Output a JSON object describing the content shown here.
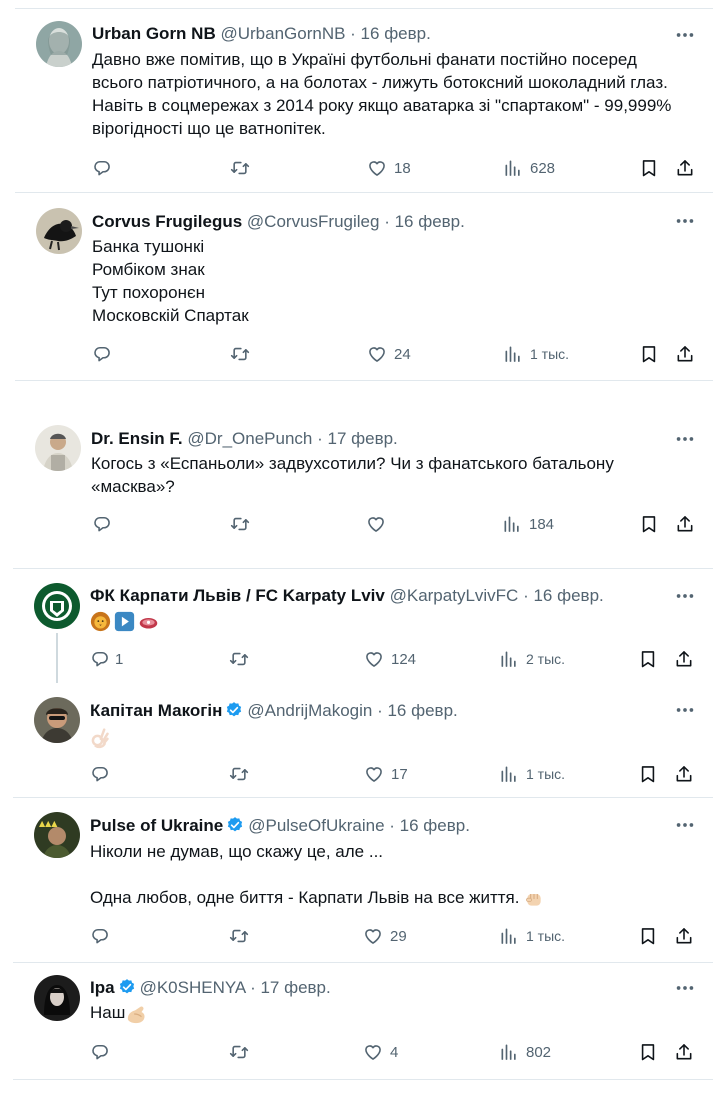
{
  "tweets": [
    {
      "name": "Urban Gorn NB",
      "handle": "@UrbanGornNB",
      "date": "· 16 февр.",
      "lines": [
        "Давно вже помітив, що в Україні футбольні фанати постійно посеред",
        "всього патріотичного, а на болотах - лижуть ботоксний шоколадний глаз.",
        "Навіть в соцмережах з 2014 року якщо аватарка зі \"спартаком\" - 99,999%",
        "вірогідності що це ватнопітек."
      ],
      "replies": "",
      "likes": "18",
      "views": "628"
    },
    {
      "name": "Corvus Frugilegus",
      "handle": "@CorvusFrugileg",
      "date": "· 16 февр.",
      "lines": [
        "Банка тушонкі",
        "Ромбіком знак",
        "Тут похоронєн",
        "Московскій Спартак"
      ],
      "replies": "",
      "likes": "24",
      "views": "1 тыс."
    },
    {
      "name": "Dr. Ensin F.",
      "handle": "@Dr_OnePunch",
      "date": "· 17 февр.",
      "lines": [
        "Когось з «Еспаньоли» задвухсотили? Чи з фанатського батальону",
        "«масква»?"
      ],
      "replies": "",
      "likes": "",
      "views": "184"
    },
    {
      "name": "ФК Карпати Львів / FC Karpaty Lviv",
      "handle": "@KarpatyLvivFC",
      "date": "· 16 февр.",
      "lines": [],
      "replies": "1",
      "likes": "124",
      "views": "2 тыс."
    },
    {
      "name": "Капітан Макогін",
      "handle": "@AndrijMakogin",
      "date": "· 16 февр.",
      "lines": [],
      "replies": "",
      "likes": "17",
      "views": "1 тыс."
    },
    {
      "name": "Pulse of Ukraine",
      "handle": "@PulseOfUkraine",
      "date": "· 16 февр.",
      "lines": [
        "Ніколи не думав, що скажу це, але ...",
        "",
        "Одна любов, одне биття - Карпати Львів на все життя."
      ],
      "replies": "",
      "likes": "29",
      "views": "1 тыс."
    },
    {
      "name": "Ipa",
      "handle": "@K0SHENYA",
      "date": "· 17 февр.",
      "lines": [
        "Наш"
      ],
      "replies": "",
      "likes": "4",
      "views": "802"
    }
  ],
  "icons": {
    "reply": "reply-icon",
    "retweet": "retweet-icon",
    "like": "heart-icon",
    "views": "views-icon",
    "bookmark": "bookmark-icon",
    "share": "share-icon",
    "more": "more-icon",
    "verified": "verified-badge-icon"
  },
  "colors": {
    "text": "#0f1419",
    "secondary": "#536471",
    "verified": "#1d9bf0",
    "divider": "#e1e8ed"
  }
}
